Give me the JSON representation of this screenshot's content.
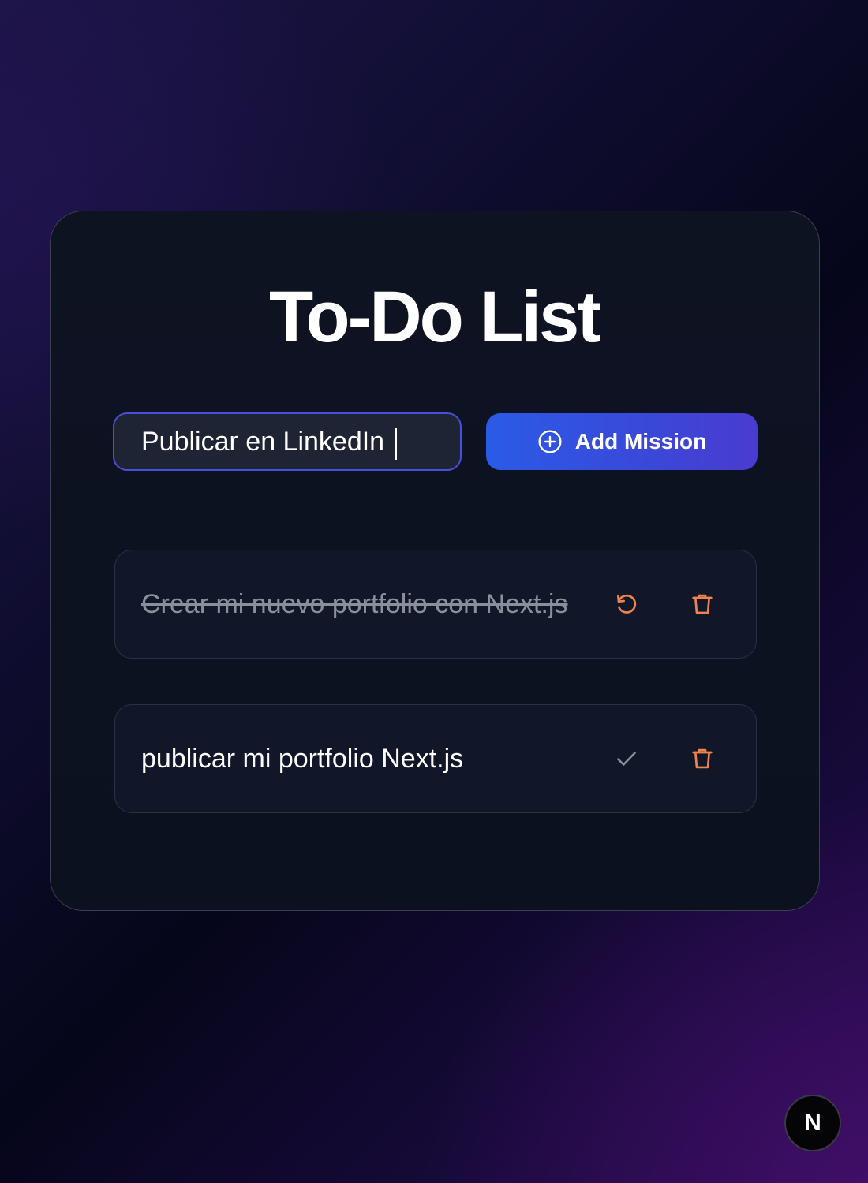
{
  "app": {
    "title": "To-Do List"
  },
  "form": {
    "input_value": "Publicar en LinkedIn",
    "add_button_label": "Add Mission",
    "add_button_icon": "plus-circle-icon"
  },
  "tasks": [
    {
      "text": "Crear mi nuevo portfolio con Next.js",
      "completed": true,
      "action_icon": "undo-icon",
      "delete_icon": "trash-icon"
    },
    {
      "text": "publicar mi portfolio Next.js",
      "completed": false,
      "action_icon": "check-icon",
      "delete_icon": "trash-icon"
    }
  ],
  "dev_badge": {
    "label": "N",
    "icon": "nextjs-logo-icon"
  },
  "colors": {
    "accent_blue": "#2a5be6",
    "accent_purple": "#4a3bd0",
    "danger_orange": "#f0844f",
    "muted_gray": "#8a8f9c"
  }
}
